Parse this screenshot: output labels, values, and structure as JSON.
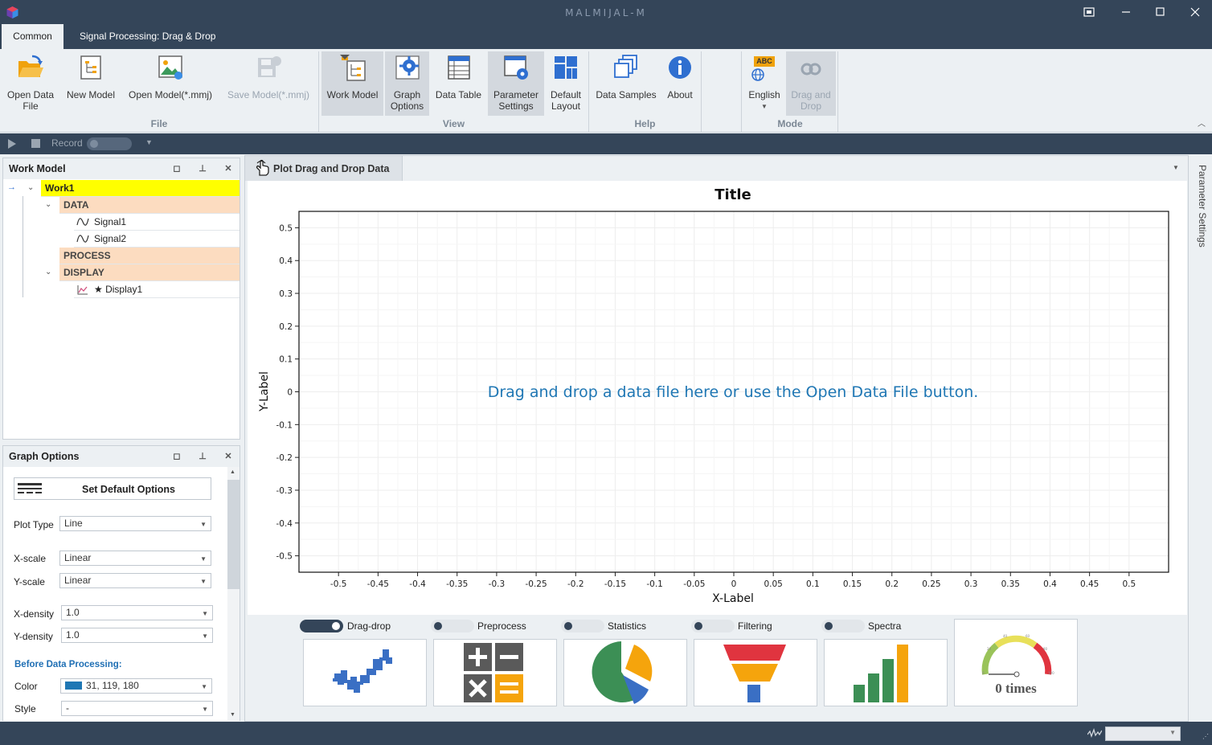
{
  "app": {
    "title": "MALMIJAL-M"
  },
  "tabs": [
    {
      "label": "Common"
    },
    {
      "label": "Signal Processing: Drag & Drop"
    }
  ],
  "ribbon": {
    "file": {
      "group_label": "File",
      "open_data_file_l1": "Open Data",
      "open_data_file_l2": "File",
      "new_model": "New Model",
      "open_model": "Open Model(*.mmj)",
      "save_model": "Save Model(*.mmj)"
    },
    "view": {
      "group_label": "View",
      "work_model": "Work Model",
      "graph_options_l1": "Graph",
      "graph_options_l2": "Options",
      "data_table": "Data Table",
      "parameter_settings_l1": "Parameter",
      "parameter_settings_l2": "Settings",
      "default_layout_l1": "Default",
      "default_layout_l2": "Layout"
    },
    "help": {
      "group_label": "Help",
      "data_samples": "Data Samples",
      "about": "About"
    },
    "mode": {
      "group_label": "Mode",
      "english": "English",
      "drag_drop_l1": "Drag and",
      "drag_drop_l2": "Drop",
      "abc": "ABC"
    }
  },
  "recordbar": {
    "record_label": "Record"
  },
  "work_model": {
    "title": "Work Model",
    "root": "Work1",
    "data_label": "DATA",
    "signals": [
      "Signal1",
      "Signal2"
    ],
    "process_label": "PROCESS",
    "display_label": "DISPLAY",
    "display_item": "★ Display1"
  },
  "graph_options": {
    "title": "Graph Options",
    "set_default": "Set Default Options",
    "plot_type_label": "Plot Type",
    "plot_type_value": "Line",
    "xscale_label": "X-scale",
    "xscale_value": "Linear",
    "yscale_label": "Y-scale",
    "yscale_value": "Linear",
    "xdensity_label": "X-density",
    "xdensity_value": "1.0",
    "ydensity_label": "Y-density",
    "ydensity_value": "1.0",
    "section_before": "Before Data Processing:",
    "color_label": "Color",
    "color_value": "31, 119, 180",
    "color_swatch": "#1f77b4",
    "style_label": "Style",
    "style_value": "-"
  },
  "document": {
    "tab_label": "Plot Drag and Drop Data",
    "placeholder": "Drag and drop a data file here or use the Open Data File button."
  },
  "chart_data": {
    "type": "line",
    "title": "Title",
    "xlabel": "X-Label",
    "ylabel": "Y-Label",
    "xlim": [
      -0.55,
      0.55
    ],
    "ylim": [
      -0.55,
      0.55
    ],
    "xticks": [
      "-0.5",
      "-0.45",
      "-0.4",
      "-0.35",
      "-0.3",
      "-0.25",
      "-0.2",
      "-0.15",
      "-0.1",
      "-0.05",
      "0",
      "0.05",
      "0.1",
      "0.15",
      "0.2",
      "0.25",
      "0.3",
      "0.35",
      "0.4",
      "0.45",
      "0.5"
    ],
    "yticks": [
      "0.5",
      "0.4",
      "0.3",
      "0.2",
      "0.1",
      "0",
      "-0.1",
      "-0.2",
      "-0.3",
      "-0.4",
      "-0.5"
    ],
    "grid": true,
    "series": []
  },
  "modes": [
    {
      "label": "Drag-drop",
      "on": true
    },
    {
      "label": "Preprocess",
      "on": false
    },
    {
      "label": "Statistics",
      "on": false
    },
    {
      "label": "Filtering",
      "on": false
    },
    {
      "label": "Spectra",
      "on": false
    }
  ],
  "counter": {
    "text": "0 times"
  },
  "side": {
    "parameter_settings": "Parameter Settings"
  },
  "colors": {
    "chrome": "#344559",
    "accent": "#1f77b4",
    "highlight": "#ffff00",
    "tree_section": "#fcdcc0"
  }
}
